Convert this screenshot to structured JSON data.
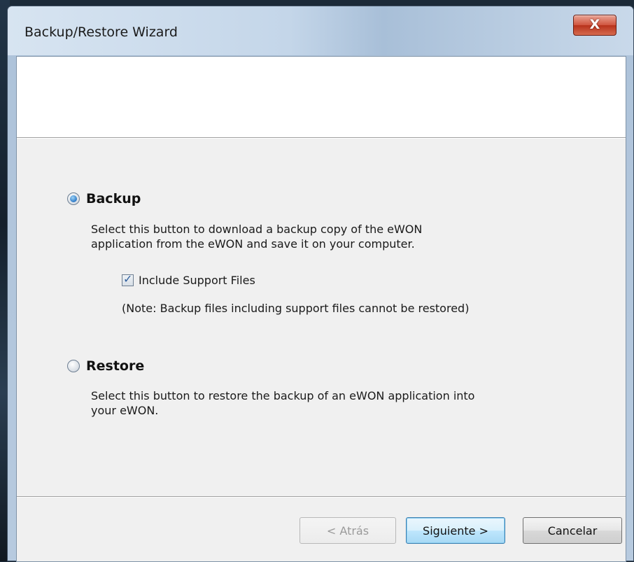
{
  "window": {
    "title": "Backup/Restore Wizard",
    "close_label": "X"
  },
  "options": {
    "backup": {
      "label": "Backup",
      "selected": true,
      "description_line1": "Select this button to download a backup copy of the eWON",
      "description_line2": "application from the eWON and save it on your computer.",
      "include_support_files": {
        "label": "Include Support Files",
        "checked": true
      },
      "note": "(Note: Backup files including support files cannot be restored)"
    },
    "restore": {
      "label": "Restore",
      "selected": false,
      "description_line1": "Select this button to restore the backup of an eWON application into",
      "description_line2": "your eWON."
    }
  },
  "buttons": {
    "back": "< Atrás",
    "next": "Siguiente >",
    "cancel": "Cancelar"
  },
  "colors": {
    "close_button": "#c7412a",
    "default_button_border": "#3c7fb1"
  },
  "icons": {
    "close": "close-icon",
    "checkbox_check": "check-mark-icon"
  }
}
